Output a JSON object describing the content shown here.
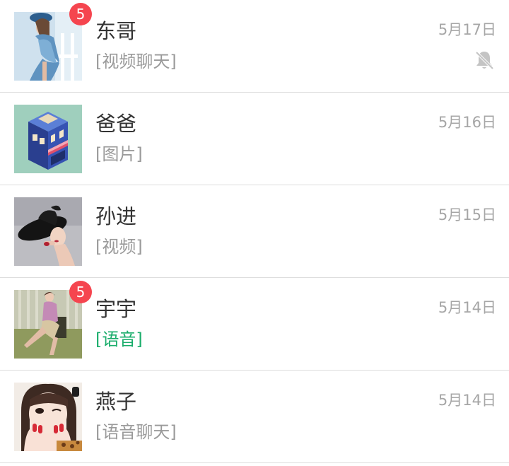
{
  "conversations": [
    {
      "name": "东哥",
      "message": "[视频聊天]",
      "time": "5月17日",
      "unread": "5",
      "muted": true,
      "avatar_icon": "woman-blue-dress-photo"
    },
    {
      "name": "爸爸",
      "message": "[图片]",
      "time": "5月16日",
      "unread": null,
      "muted": false,
      "avatar_icon": "isometric-shop-building-illustration"
    },
    {
      "name": "孙进",
      "message": "[视频]",
      "time": "5月15日",
      "unread": null,
      "muted": false,
      "avatar_icon": "woman-black-hat-photo"
    },
    {
      "name": "宇宇",
      "message": "[语音]",
      "time": "5月14日",
      "unread": "5",
      "muted": false,
      "avatar_icon": "woman-sitting-fashion-photo"
    },
    {
      "name": "燕子",
      "message": "[语音聊天]",
      "time": "5月14日",
      "unread": null,
      "muted": false,
      "avatar_icon": "girl-hands-on-face-illustration"
    }
  ],
  "colors": {
    "badge": "#f5454f",
    "voice_message": "#1aad6b",
    "name_text": "#333333",
    "secondary_text": "#9a9a9a",
    "divider": "#dedede"
  }
}
